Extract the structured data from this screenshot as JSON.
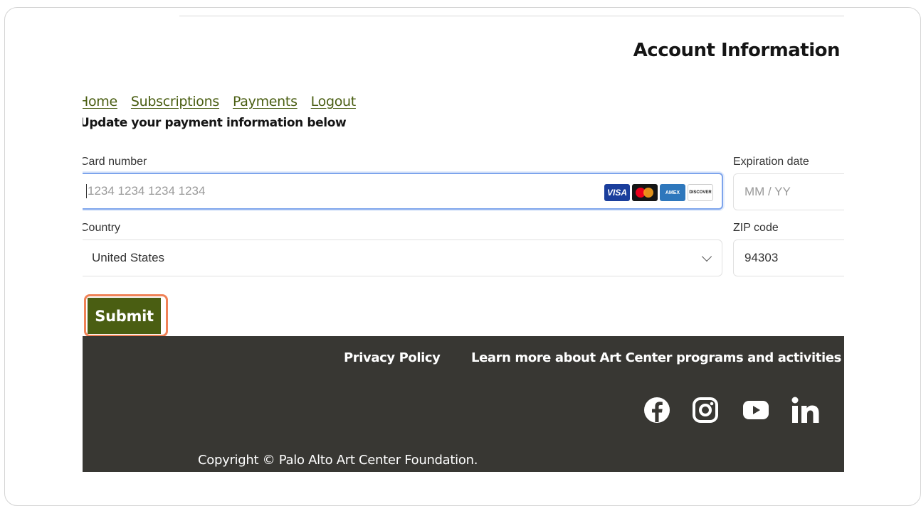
{
  "page": {
    "title": "Account Information",
    "nav": [
      "Home",
      "Subscriptions",
      "Payments",
      "Logout"
    ],
    "subtitle": "Update your payment information below"
  },
  "form": {
    "card_label": "Card number",
    "card_placeholder": "1234 1234 1234 1234",
    "card_brands": [
      "VISA",
      "Mastercard",
      "AMEX",
      "DISCOVER"
    ],
    "expiry_label": "Expiration date",
    "expiry_placeholder": "MM / YY",
    "country_label": "Country",
    "country_value": "United States",
    "zip_label": "ZIP code",
    "zip_value": "94303",
    "submit_label": "Submit"
  },
  "footer": {
    "privacy": "Privacy Policy",
    "learn_more": "Learn more about Art Center programs and activities",
    "social": [
      "facebook-icon",
      "instagram-icon",
      "youtube-icon",
      "linkedin-icon"
    ],
    "copyright": "Copyright © Palo Alto Art Center Foundation."
  },
  "colors": {
    "brand_green": "#4a5e12",
    "footer_bg": "#383733",
    "highlight": "#f08257"
  }
}
